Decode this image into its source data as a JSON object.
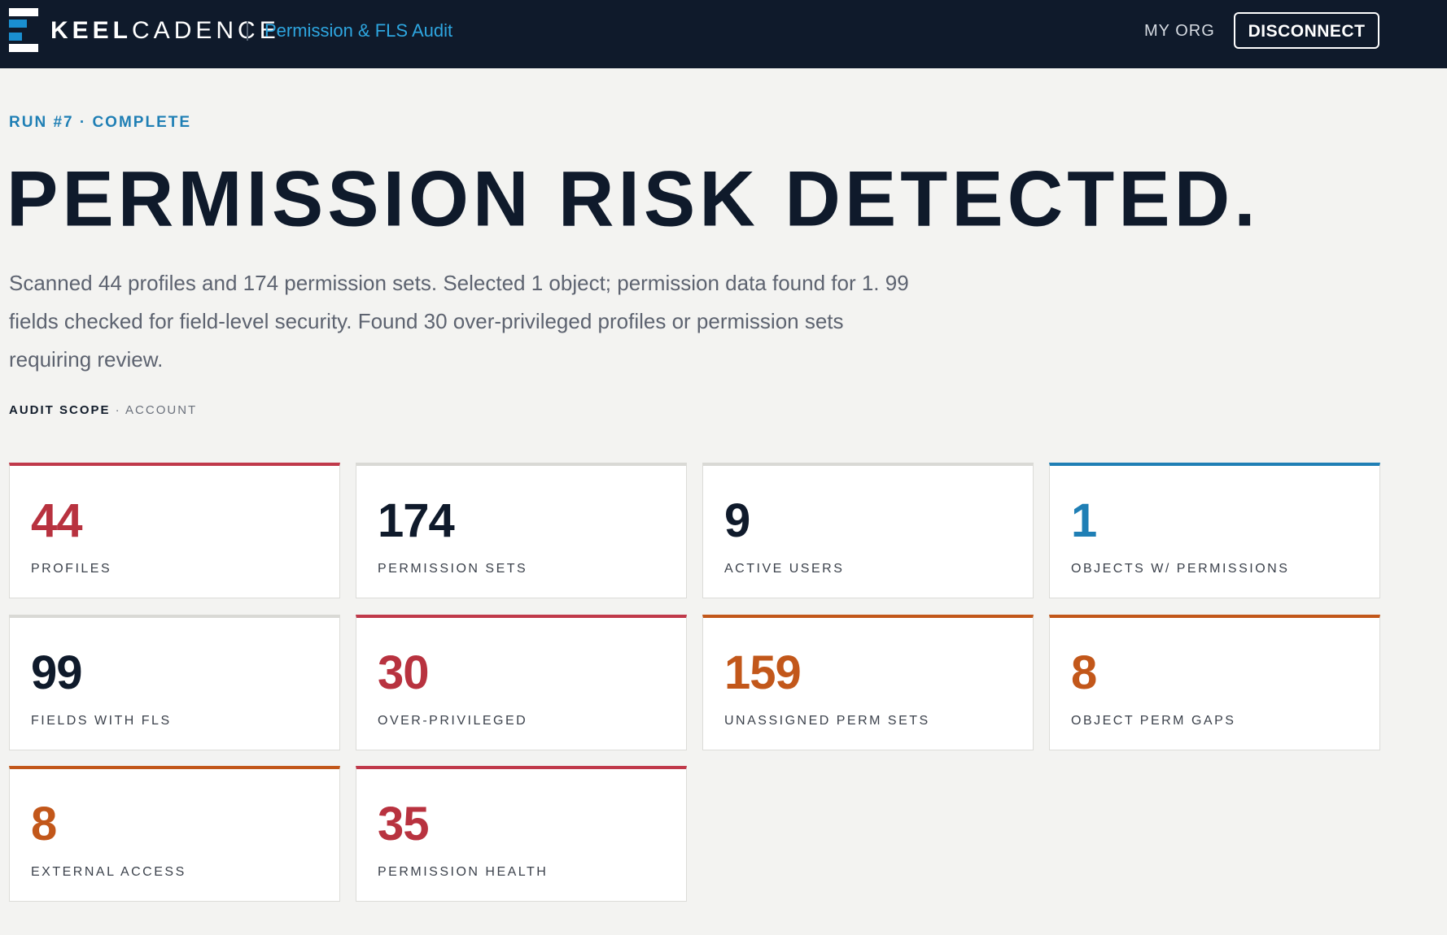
{
  "header": {
    "brand_strong": "KEEL",
    "brand_light": "CADENCE",
    "app_title": "Permission & FLS Audit",
    "org_label": "MY ORG",
    "disconnect_label": "DISCONNECT",
    "logo_icon": "keelcadence-logo-icon"
  },
  "hero": {
    "run_status": "RUN #7 · COMPLETE",
    "title": "PERMISSION RISK DETECTED.",
    "summary": "Scanned 44 profiles and 174 permission sets. Selected 1 object; permission data found for 1. 99 fields checked for field-level security. Found 30 over-privileged profiles or permission sets requiring review.",
    "scope_label": "AUDIT SCOPE",
    "scope_separator": " · ",
    "scope_value": "ACCOUNT"
  },
  "colors": {
    "red": "#b8323f",
    "navy": "#0f1a2b",
    "blue": "#1f7fb5",
    "orange": "#c2571a",
    "topbar": "#0f1a2b",
    "accent_link": "#2ea6e0"
  },
  "stats": [
    {
      "value": "44",
      "label": "PROFILES",
      "tone": "red"
    },
    {
      "value": "174",
      "label": "PERMISSION SETS",
      "tone": "navy"
    },
    {
      "value": "9",
      "label": "ACTIVE USERS",
      "tone": "navy"
    },
    {
      "value": "1",
      "label": "OBJECTS W/ PERMISSIONS",
      "tone": "blue"
    },
    {
      "value": "99",
      "label": "FIELDS WITH FLS",
      "tone": "navy"
    },
    {
      "value": "30",
      "label": "OVER-PRIVILEGED",
      "tone": "red"
    },
    {
      "value": "159",
      "label": "UNASSIGNED PERM SETS",
      "tone": "orange"
    },
    {
      "value": "8",
      "label": "OBJECT PERM GAPS",
      "tone": "orange"
    },
    {
      "value": "8",
      "label": "EXTERNAL ACCESS",
      "tone": "orange"
    },
    {
      "value": "35",
      "label": "PERMISSION HEALTH",
      "tone": "red"
    }
  ]
}
